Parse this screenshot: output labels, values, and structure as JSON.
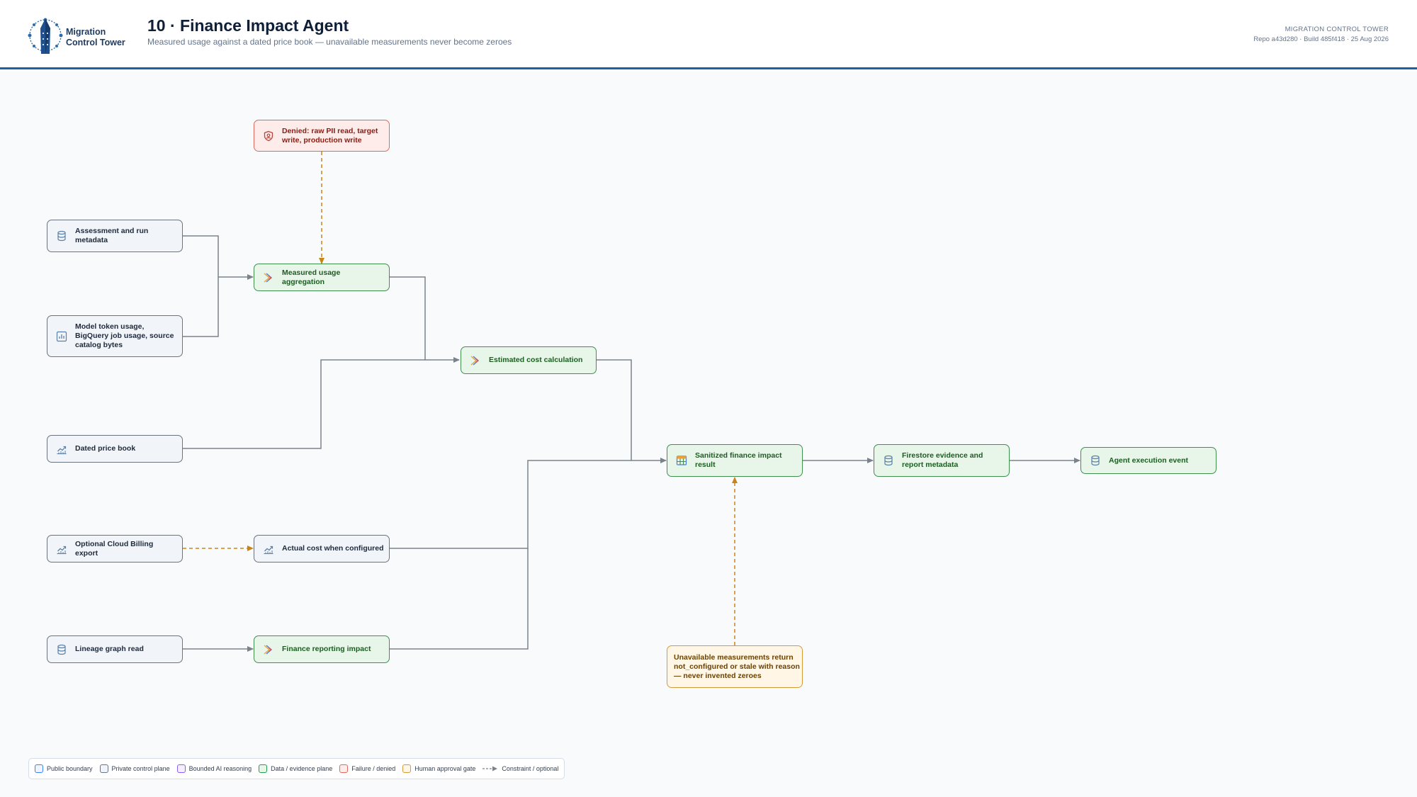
{
  "header": {
    "logo_line1": "Migration",
    "logo_line2": "Control Tower",
    "title": "10 · Finance Impact Agent",
    "subtitle": "Measured usage against a dated price book — unavailable measurements never become zeroes",
    "meta_title": "MIGRATION CONTROL TOWER",
    "meta_build": "Repo a43d280 · Build 485f418 · 25 Aug 2026"
  },
  "nodes": {
    "denied": "Denied: raw PII read, target write, production write",
    "assessment": "Assessment and run metadata",
    "model_usage": "Model token usage, BigQuery job usage, source catalog bytes",
    "measured": "Measured usage aggregation",
    "estimated": "Estimated cost calculation",
    "price_book": "Dated price book",
    "billing_export": "Optional Cloud Billing export",
    "actual_cost": "Actual cost when configured",
    "lineage": "Lineage graph read",
    "finance_reporting": "Finance reporting impact",
    "sanitized": "Sanitized finance impact result",
    "firestore": "Firestore evidence and report metadata",
    "agent_event": "Agent execution event",
    "unavailable": "Unavailable measurements return not_configured or stale with reason — never invented zeroes"
  },
  "legend": [
    {
      "label": "Public boundary",
      "color": "#3b82f6"
    },
    {
      "label": "Private control plane",
      "color": "#64748b"
    },
    {
      "label": "Bounded AI reasoning",
      "color": "#8b5cf6"
    },
    {
      "label": "Data / evidence plane",
      "color": "#22a04b"
    },
    {
      "label": "Failure / denied",
      "color": "#e0695e"
    },
    {
      "label": "Human approval gate",
      "color": "#d49a3a"
    }
  ],
  "legend_constraint": "Constraint / optional",
  "colors": {
    "accent": "#1f5fa6",
    "wire": "#7a828c",
    "constraint": "#c98418"
  }
}
